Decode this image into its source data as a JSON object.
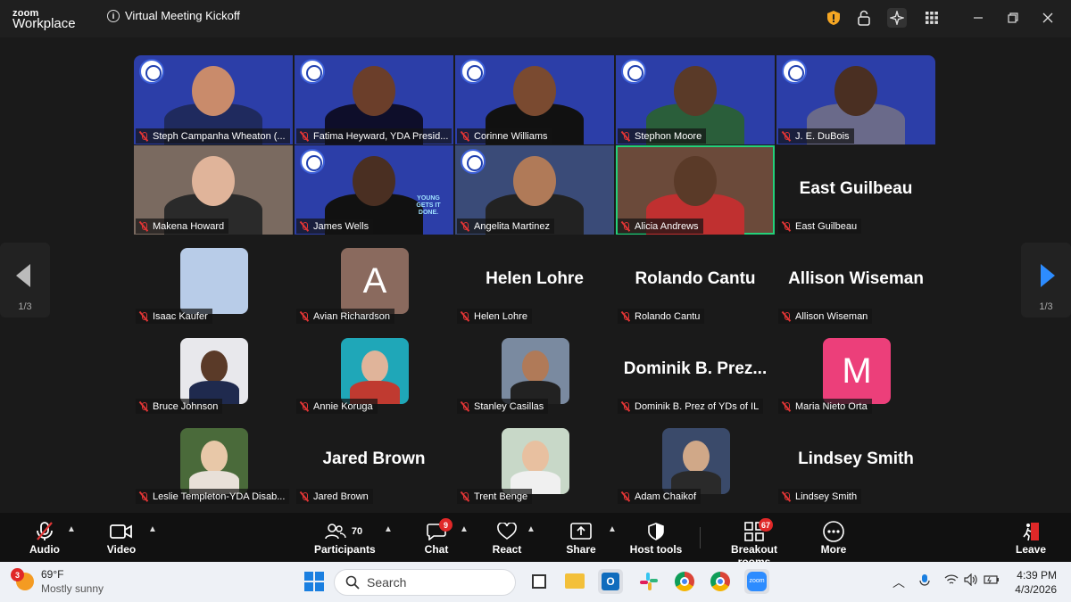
{
  "app": {
    "logo_line1": "zoom",
    "logo_line2": "Workplace",
    "meeting_title": "Virtual Meeting Kickoff"
  },
  "gallery": {
    "page_indicator_left": "1/3",
    "page_indicator_right": "1/3",
    "participants": [
      {
        "name": "Steph Campanha Wheaton (...",
        "kind": "video"
      },
      {
        "name": "Fatima Heyward, YDA Presid...",
        "kind": "video"
      },
      {
        "name": "Corinne Williams",
        "kind": "video"
      },
      {
        "name": "Stephon Moore",
        "kind": "video"
      },
      {
        "name": "J. E. DuBois",
        "kind": "video"
      },
      {
        "name": "Makena Howard",
        "kind": "video"
      },
      {
        "name": "James Wells",
        "kind": "video",
        "overlay": "YOUNG GETS IT DONE."
      },
      {
        "name": "Angelita Martinez",
        "kind": "video"
      },
      {
        "name": "Alicia Andrews",
        "kind": "video",
        "speaking": true
      },
      {
        "name": "East Guilbeau",
        "kind": "text",
        "big": "East Guilbeau"
      },
      {
        "name": "Isaac Kaufer",
        "kind": "blank-avatar"
      },
      {
        "name": "Avian Richardson",
        "kind": "letter-avatar",
        "letter": "A"
      },
      {
        "name": "Helen Lohre",
        "kind": "text",
        "big": "Helen Lohre"
      },
      {
        "name": "Rolando Cantu",
        "kind": "text",
        "big": "Rolando Cantu"
      },
      {
        "name": "Allison Wiseman",
        "kind": "text",
        "big": "Allison Wiseman"
      },
      {
        "name": "Bruce Johnson",
        "kind": "photo"
      },
      {
        "name": "Annie Koruga",
        "kind": "photo"
      },
      {
        "name": "Stanley Casillas",
        "kind": "photo"
      },
      {
        "name": "Dominik B. Prez of YDs of IL",
        "kind": "text",
        "big": "Dominik B. Prez..."
      },
      {
        "name": "Maria Nieto Orta",
        "kind": "letter-avatar",
        "letter": "M"
      },
      {
        "name": "Leslie Templeton-YDA Disab...",
        "kind": "photo"
      },
      {
        "name": "Jared Brown",
        "kind": "text",
        "big": "Jared Brown"
      },
      {
        "name": "Trent Benge",
        "kind": "photo"
      },
      {
        "name": "Adam Chaikof",
        "kind": "photo"
      },
      {
        "name": "Lindsey Smith",
        "kind": "text",
        "big": "Lindsey Smith"
      }
    ]
  },
  "toolbar": {
    "audio": "Audio",
    "video": "Video",
    "participants": "Participants",
    "participants_count": "70",
    "chat": "Chat",
    "chat_badge": "9",
    "react": "React",
    "share": "Share",
    "host_tools": "Host tools",
    "breakout_rooms": "Breakout rooms",
    "breakout_badge": "67",
    "more": "More",
    "leave": "Leave"
  },
  "taskbar": {
    "weather_badge": "3",
    "temperature": "69°F",
    "weather_desc": "Mostly sunny",
    "search_placeholder": "Search",
    "time": "4:39 PM",
    "date": "4/3/2026"
  },
  "colors": {
    "accent": "#2d8cff",
    "speaking_border": "#23d17a",
    "muted_red": "#e03535",
    "video_bg": "#2c3ea8"
  }
}
